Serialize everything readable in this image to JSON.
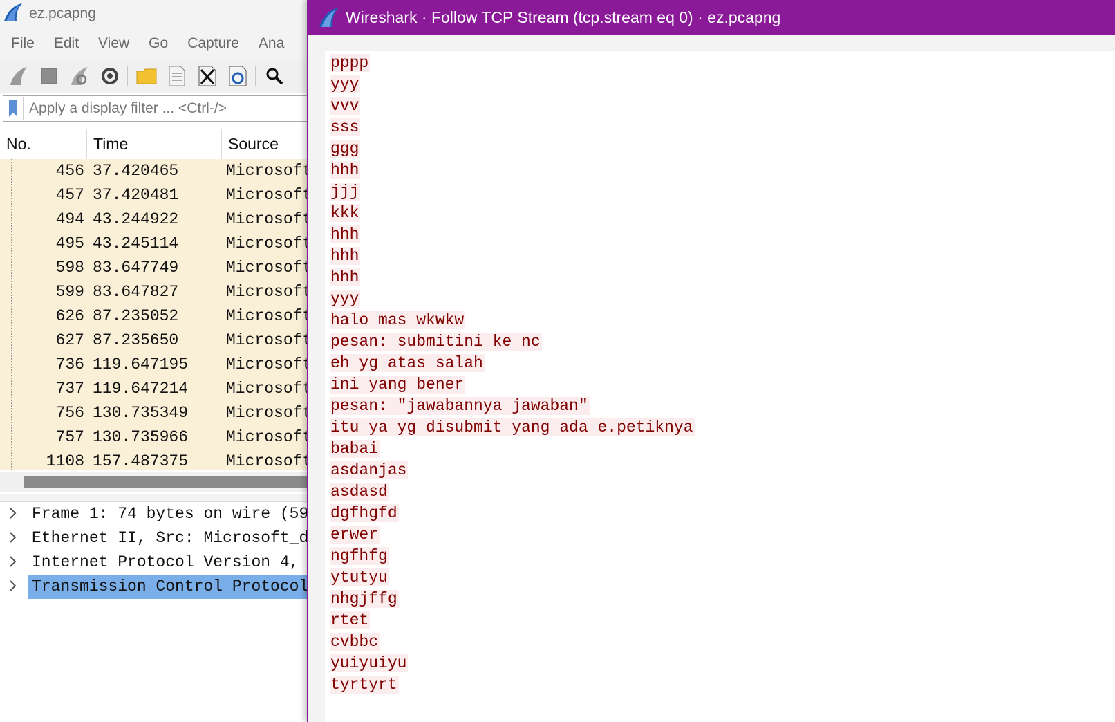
{
  "main": {
    "title": "ez.pcapng",
    "menu": [
      "File",
      "Edit",
      "View",
      "Go",
      "Capture",
      "Ana"
    ],
    "filter_placeholder": "Apply a display filter ... <Ctrl-/>",
    "columns": [
      "No.",
      "Time",
      "Source"
    ],
    "packets": [
      {
        "no": "456",
        "time": "37.420465",
        "source": "Microsoft"
      },
      {
        "no": "457",
        "time": "37.420481",
        "source": "Microsoft"
      },
      {
        "no": "494",
        "time": "43.244922",
        "source": "Microsoft"
      },
      {
        "no": "495",
        "time": "43.245114",
        "source": "Microsoft"
      },
      {
        "no": "598",
        "time": "83.647749",
        "source": "Microsoft"
      },
      {
        "no": "599",
        "time": "83.647827",
        "source": "Microsoft"
      },
      {
        "no": "626",
        "time": "87.235052",
        "source": "Microsoft"
      },
      {
        "no": "627",
        "time": "87.235650",
        "source": "Microsoft"
      },
      {
        "no": "736",
        "time": "119.647195",
        "source": "Microsoft"
      },
      {
        "no": "737",
        "time": "119.647214",
        "source": "Microsoft"
      },
      {
        "no": "756",
        "time": "130.735349",
        "source": "Microsoft"
      },
      {
        "no": "757",
        "time": "130.735966",
        "source": "Microsoft"
      },
      {
        "no": "1108",
        "time": "157.487375",
        "source": "Microsoft"
      }
    ],
    "details": [
      {
        "text": "Frame 1: 74 bytes on wire (59",
        "selected": false
      },
      {
        "text": "Ethernet II, Src: Microsoft_d",
        "selected": false
      },
      {
        "text": "Internet Protocol Version 4,",
        "selected": false
      },
      {
        "text": "Transmission Control Protocol",
        "selected": true
      }
    ],
    "colors": {
      "packet_row_bg": "#faf0d8",
      "selected_bg": "#7aaee8"
    }
  },
  "dialog": {
    "title": "Wireshark · Follow TCP Stream (tcp.stream eq 0) · ez.pcapng",
    "titlebar_color": "#8b1a99",
    "text_color": "#800000",
    "highlight_color": "#fbeded",
    "stream_lines": [
      "pppp",
      "yyy",
      "vvv",
      "sss",
      "ggg",
      "hhh",
      "jjj",
      "kkk",
      "hhh",
      "hhh",
      "hhh",
      "yyy",
      "halo mas wkwkw",
      "pesan: submitini ke nc",
      "eh yg atas salah",
      "ini yang bener",
      "pesan: \"jawabannya jawaban\"",
      "itu ya yg disubmit yang ada e.petiknya",
      "babai",
      "asdanjas",
      "asdasd",
      "dgfhgfd",
      "erwer",
      "ngfhfg",
      "ytutyu",
      "nhgjffg",
      "rtet",
      "cvbbc",
      "yuiyuiyu",
      "tyrtyrt"
    ]
  },
  "icons": {
    "app": "wireshark-fin-icon",
    "toolbar": [
      "start-capture-icon",
      "stop-capture-icon",
      "restart-capture-icon",
      "capture-options-icon",
      "open-file-icon",
      "save-file-icon",
      "close-file-icon",
      "reload-file-icon",
      "find-packet-icon"
    ]
  }
}
